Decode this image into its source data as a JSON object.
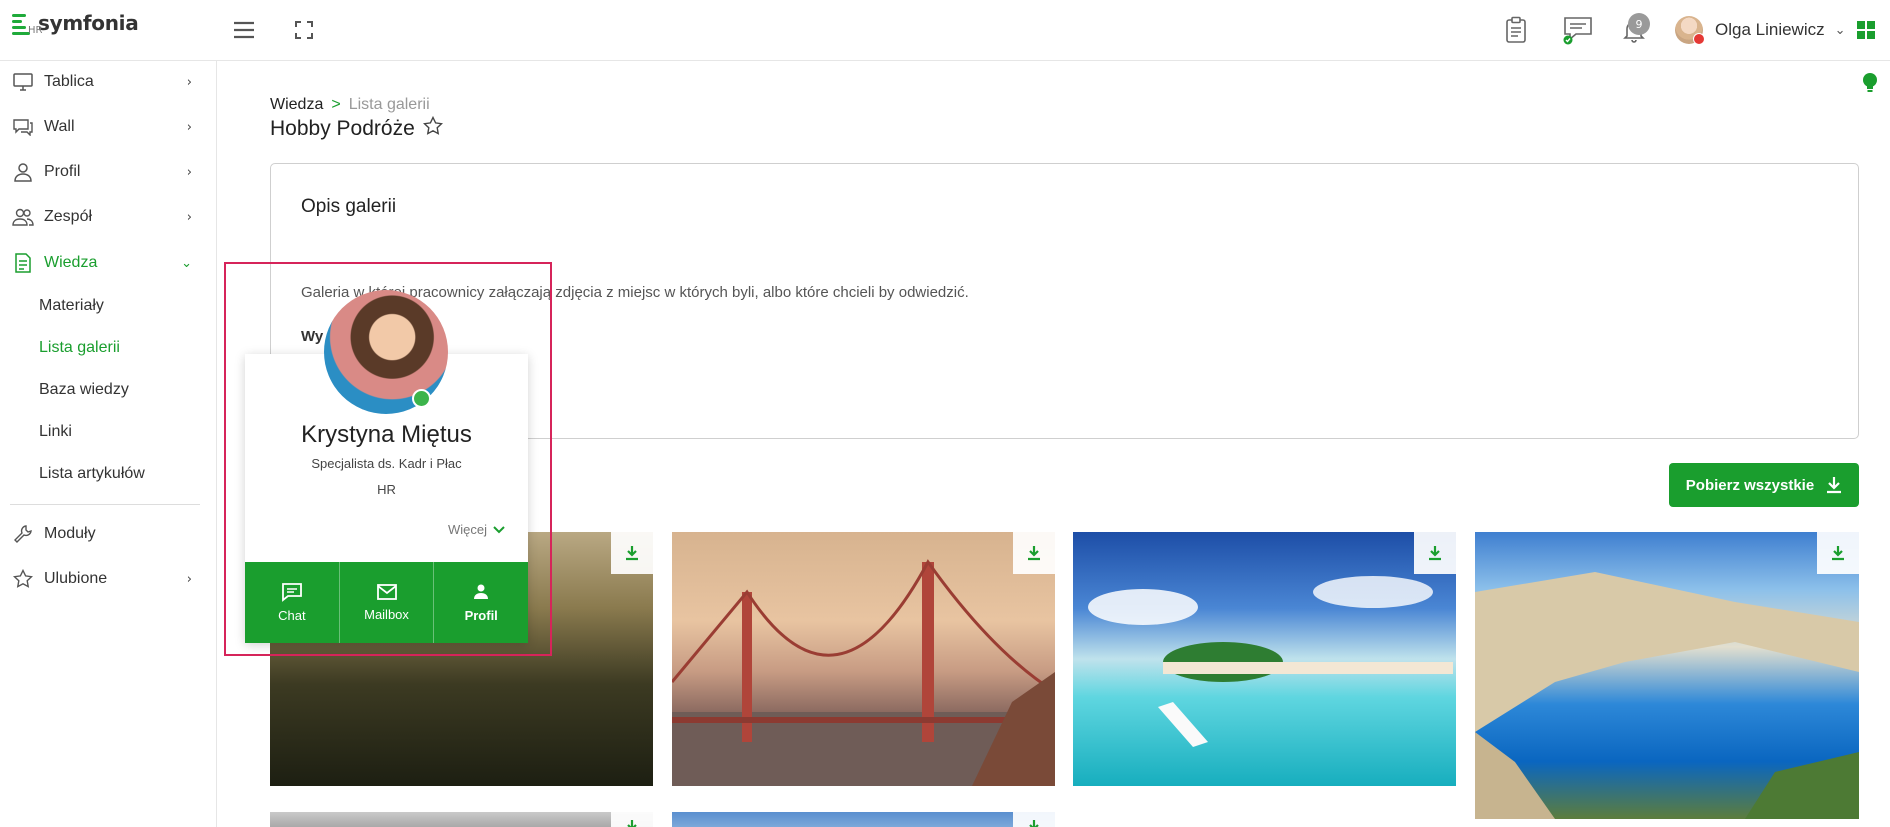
{
  "app": {
    "name": "symfonia",
    "module": "HR"
  },
  "header": {
    "notifications_count": "9",
    "user_name": "Olga Liniewicz"
  },
  "sidebar": {
    "items": [
      {
        "label": "Tablica",
        "icon": "monitor-icon"
      },
      {
        "label": "Wall",
        "icon": "chat-icon"
      },
      {
        "label": "Profil",
        "icon": "person-icon"
      },
      {
        "label": "Zespół",
        "icon": "team-icon"
      },
      {
        "label": "Wiedza",
        "icon": "document-icon",
        "active": true
      }
    ],
    "subitems": [
      "Materiały",
      "Lista galerii",
      "Baza wiedzy",
      "Linki",
      "Lista artykułów"
    ],
    "active_subitem": "Lista galerii",
    "bottom_items": [
      {
        "label": "Moduły",
        "icon": "wrench-icon"
      },
      {
        "label": "Ulubione",
        "icon": "star-icon"
      }
    ]
  },
  "breadcrumb": {
    "root": "Wiedza",
    "separator": ">",
    "current": "Lista galerii"
  },
  "page": {
    "title": "Hobby Podróże"
  },
  "description": {
    "title": "Opis galerii",
    "text": "Galeria w której pracownicy załączają zdjęcia z miejsc w których byli, albo które chcieli by odwiedzić.",
    "more_label": "Wy"
  },
  "actions": {
    "download_all": "Pobierz wszystkie"
  },
  "popup": {
    "name": "Krystyna Miętus",
    "role": "Specjalista ds. Kadr i Płac",
    "department": "HR",
    "more": "Więcej",
    "buttons": [
      "Chat",
      "Mailbox",
      "Profil"
    ]
  },
  "colors": {
    "accent": "#1a9e2e",
    "highlight": "#d6245a"
  }
}
